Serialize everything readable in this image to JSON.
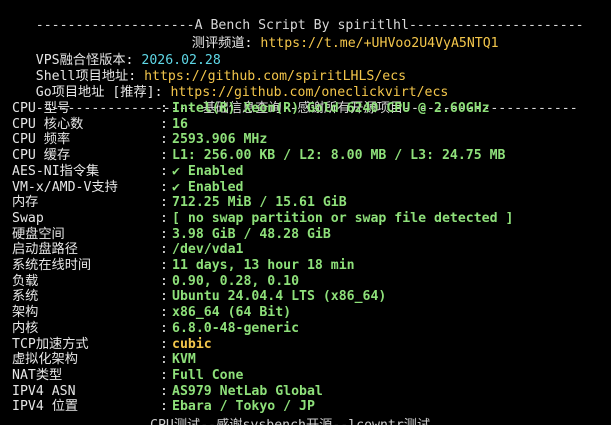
{
  "header": {
    "dash_left": "--------------------",
    "title": "A Bench Script By spiritlhl",
    "dash_right": "----------------------",
    "channel_label": "测评频道: ",
    "channel_url": "https://t.me/+UHVoo2U4VyA5NTQ1",
    "version_label": "VPS融合怪版本: ",
    "version_value": "2026.02.28",
    "shell_label": "Shell项目地址: ",
    "shell_url": "https://github.com/spiritLHLS/ecs",
    "go_label": "Go项目地址 [推荐]: ",
    "go_url": "https://github.com/oneclickvirt/ecs",
    "section_dash_left": "---------------------",
    "section_title": "基础信息查询--感谢所有开源项目",
    "section_dash_right": "----------------------"
  },
  "rows": [
    {
      "label": "CPU 型号",
      "value": "Intel(R) Xeon(R) Gold 6240 CPU @ 2.60GHz",
      "style": "green"
    },
    {
      "label": "CPU 核心数",
      "value": "16",
      "style": "green"
    },
    {
      "label": "CPU 频率",
      "value": "2593.906 MHz",
      "style": "green"
    },
    {
      "label": "CPU 缓存",
      "value": "L1: 256.00 KB / L2: 8.00 MB / L3: 24.75 MB",
      "style": "green"
    },
    {
      "label": "AES-NI指令集",
      "value": "✔ Enabled",
      "style": "green"
    },
    {
      "label": "VM-x/AMD-V支持",
      "value": "✔ Enabled",
      "style": "green"
    },
    {
      "label": "内存",
      "value": "712.25 MiB / 15.61 GiB",
      "style": "green"
    },
    {
      "label": "Swap",
      "value": "[ no swap partition or swap file detected ]",
      "style": "green"
    },
    {
      "label": "硬盘空间",
      "value": "3.98 GiB / 48.28 GiB",
      "style": "green"
    },
    {
      "label": "启动盘路径",
      "value": "/dev/vda1",
      "style": "green"
    },
    {
      "label": "系统在线时间",
      "value": "11 days, 13 hour 18 min",
      "style": "green"
    },
    {
      "label": "负载",
      "value": "0.90, 0.28, 0.10",
      "style": "green"
    },
    {
      "label": "系统",
      "value": "Ubuntu 24.04.4 LTS (x86_64)",
      "style": "green"
    },
    {
      "label": "架构",
      "value": "x86_64 (64 Bit)",
      "style": "green"
    },
    {
      "label": "内核",
      "value": "6.8.0-48-generic",
      "style": "green"
    },
    {
      "label": "TCP加速方式",
      "value": "cubic",
      "style": "yellow"
    },
    {
      "label": "虚拟化架构",
      "value": "KVM",
      "style": "green"
    },
    {
      "label": "NAT类型",
      "value": "Full Cone",
      "style": "green"
    },
    {
      "label": "IPV4 ASN",
      "value": "AS979 NetLab Global",
      "style": "green"
    },
    {
      "label": "IPV4 位置",
      "value": "Ebara / Tokyo / JP",
      "style": "green"
    }
  ],
  "separator": ": ",
  "colors": {
    "background": "#000000",
    "text": "#d9d9d9",
    "link": "#f3c64b",
    "value_green": "#8ee07a",
    "value_cyan": "#5fd7e6",
    "value_yellow": "#f3c64b"
  }
}
